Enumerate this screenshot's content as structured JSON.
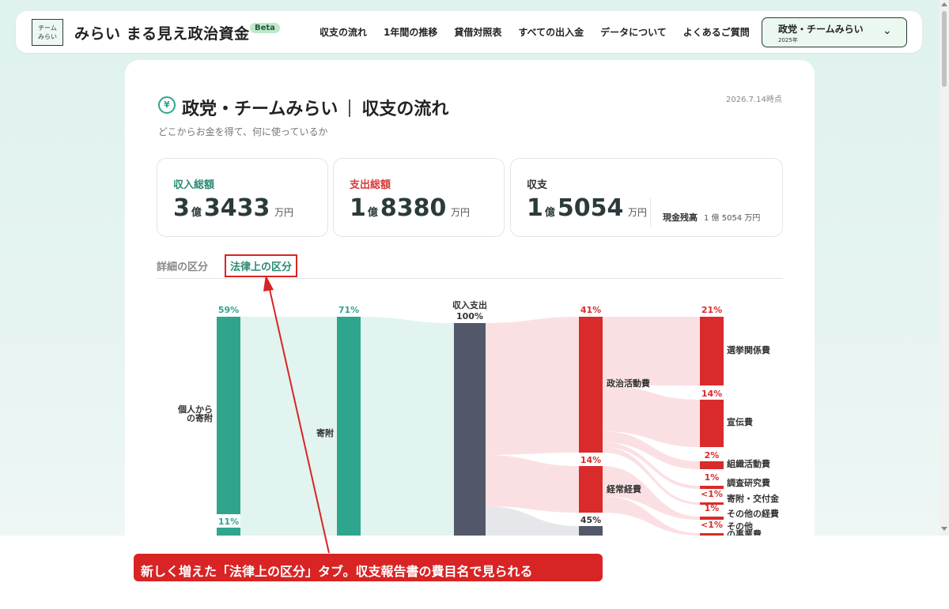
{
  "header": {
    "logo_text_top": "チーム",
    "logo_text_bottom": "みらい",
    "brand": "みらい まる見え政治資金",
    "beta": "Beta",
    "nav": [
      "収支の流れ",
      "1年間の推移",
      "貸借対照表",
      "すべての出入金",
      "データについて",
      "よくあるご質問"
    ],
    "party_select": {
      "name": "政党・チームみらい",
      "year": "2025年"
    }
  },
  "page": {
    "title_party": "政党・チームみらい",
    "title_section": "収支の流れ",
    "subtitle": "どこからお金を得て、何に使っているか",
    "as_of": "2026.7.14時点"
  },
  "summary": {
    "income": {
      "label": "収入総額",
      "oku": "3",
      "man": "3433",
      "oku_unit": "億",
      "man_unit": "万円"
    },
    "expense": {
      "label": "支出総額",
      "oku": "1",
      "man": "8380",
      "oku_unit": "億",
      "man_unit": "万円"
    },
    "balance": {
      "label": "収支",
      "oku": "1",
      "man": "5054",
      "oku_unit": "億",
      "man_unit": "万円",
      "cash_label": "現金残高",
      "cash_value": "1 億 5054 万円"
    }
  },
  "tabs": {
    "detail": "詳細の区分",
    "legal": "法律上の区分",
    "active": "legal"
  },
  "chart_data": {
    "type": "sankey",
    "colors": {
      "income": "#2fa58e",
      "expense": "#d92b2b",
      "center": "#525869",
      "income_link": "#e1f4f0",
      "expense_link": "#fbe0e3",
      "balance_link": "#e6e7ea"
    },
    "nodes": [
      {
        "id": "individual",
        "label_lines": [
          "個人から",
          "の寄附"
        ],
        "pct": "59%",
        "side": "income"
      },
      {
        "id": "other_income",
        "label_lines": [],
        "pct": "11%",
        "side": "income"
      },
      {
        "id": "donation",
        "label_lines": [
          "寄附"
        ],
        "pct": "71%",
        "side": "income"
      },
      {
        "id": "center",
        "label_lines": [
          "収入支出",
          "100%"
        ],
        "pct": "",
        "side": "center"
      },
      {
        "id": "political",
        "label_lines": [
          "政治活動費"
        ],
        "pct": "41%",
        "side": "expense"
      },
      {
        "id": "ordinary",
        "label_lines": [
          "経常経費"
        ],
        "pct": "14%",
        "side": "expense"
      },
      {
        "id": "balance_node",
        "label_lines": [],
        "pct": "45%",
        "side": "balance"
      }
    ],
    "leaves": [
      {
        "label_lines": [
          "選挙関係費"
        ],
        "pct": "21%"
      },
      {
        "label_lines": [
          "宣伝費"
        ],
        "pct": "14%"
      },
      {
        "label_lines": [
          "組織活動費"
        ],
        "pct": "2%"
      },
      {
        "label_lines": [
          "調査研究費"
        ],
        "pct": "1%"
      },
      {
        "label_lines": [
          "寄附・交付金"
        ],
        "pct": "<1%"
      },
      {
        "label_lines": [
          "その他の経費"
        ],
        "pct": "1%"
      },
      {
        "label_lines": [
          "その他",
          "の事業費"
        ],
        "pct": "<1%"
      }
    ]
  },
  "annotation": {
    "caption": "新しく増えた「法律上の区分」タブ。収支報告書の費目名で見られる"
  }
}
